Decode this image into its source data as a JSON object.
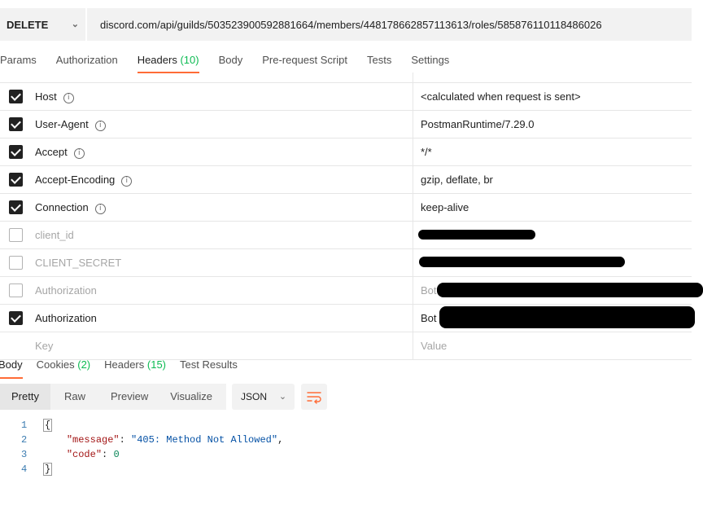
{
  "request": {
    "method": "DELETE",
    "url": "discord.com/api/guilds/503523900592881664/members/448178662857113613/roles/585876110118486026"
  },
  "request_tabs": [
    {
      "label": "Params",
      "count": ""
    },
    {
      "label": "Authorization",
      "count": ""
    },
    {
      "label": "Headers",
      "count": "(10)"
    },
    {
      "label": "Body",
      "count": ""
    },
    {
      "label": "Pre-request Script",
      "count": ""
    },
    {
      "label": "Tests",
      "count": ""
    },
    {
      "label": "Settings",
      "count": ""
    }
  ],
  "active_request_tab": "Headers",
  "headers": [
    {
      "checked": true,
      "key": "Host",
      "value": "<calculated when request is sent>"
    },
    {
      "checked": true,
      "key": "User-Agent",
      "value": "PostmanRuntime/7.29.0"
    },
    {
      "checked": true,
      "key": "Accept",
      "value": "*/*"
    },
    {
      "checked": true,
      "key": "Accept-Encoding",
      "value": "gzip, deflate, br"
    },
    {
      "checked": true,
      "key": "Connection",
      "value": "keep-alive"
    },
    {
      "checked": false,
      "key": "client_id",
      "value": ""
    },
    {
      "checked": false,
      "key": "CLIENT_SECRET",
      "value": ""
    },
    {
      "checked": false,
      "key": "Authorization",
      "value": "Bot"
    },
    {
      "checked": true,
      "key": "Authorization",
      "value": "Bot"
    }
  ],
  "new_row": {
    "key_placeholder": "Key",
    "value_placeholder": "Value"
  },
  "response_tabs": [
    {
      "label": "Body",
      "count": ""
    },
    {
      "label": "Cookies",
      "count": "(2)"
    },
    {
      "label": "Headers",
      "count": "(15)"
    },
    {
      "label": "Test Results",
      "count": ""
    }
  ],
  "view_modes": [
    "Pretty",
    "Raw",
    "Preview",
    "Visualize"
  ],
  "active_view_mode": "Pretty",
  "format": "JSON",
  "response_body": {
    "lines": [
      "1",
      "2",
      "3",
      "4"
    ],
    "open_brace": "{",
    "close_brace": "}",
    "message_key": "\"message\"",
    "message_value": "\"405: Method Not Allowed\"",
    "code_key": "\"code\"",
    "code_value": "0"
  },
  "colors": {
    "accent": "#ff6c37",
    "count_green": "#0cbb52"
  }
}
